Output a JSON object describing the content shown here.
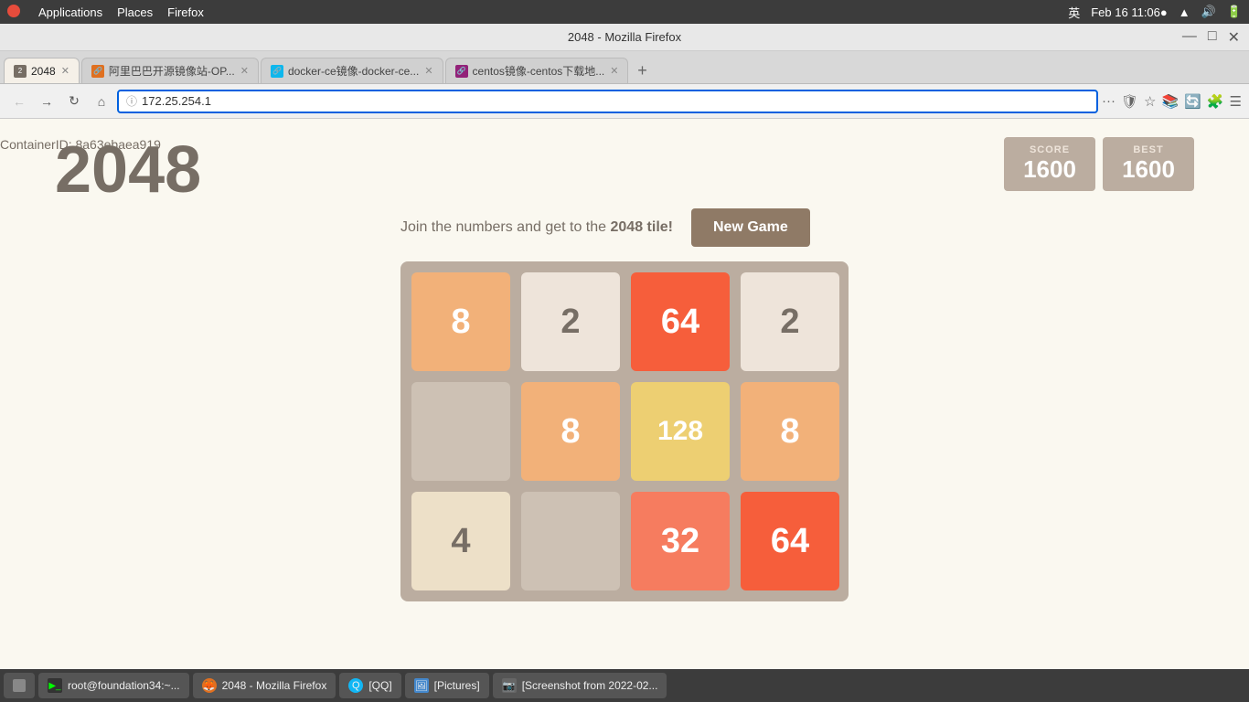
{
  "os": {
    "topbar": {
      "applications": "Applications",
      "places": "Places",
      "firefox": "Firefox",
      "lang": "英",
      "date": "Feb 16  11:06●",
      "wifi_icon": "wifi",
      "speaker_icon": "speaker",
      "battery_icon": "battery"
    }
  },
  "browser": {
    "title": "2048 - Mozilla Firefox",
    "win_controls": [
      "—",
      "□",
      "✕"
    ],
    "tabs": [
      {
        "id": "tab-2048",
        "label": "2048",
        "active": true,
        "icon": "2048"
      },
      {
        "id": "tab-alibaba",
        "label": "阿里巴巴开源镜像站-OP...",
        "active": false,
        "icon": "A"
      },
      {
        "id": "tab-docker",
        "label": "docker-ce镜像-docker-ce...",
        "active": false,
        "icon": "D"
      },
      {
        "id": "tab-centos",
        "label": "centos镜像-centos下载地...",
        "active": false,
        "icon": "C"
      }
    ],
    "new_tab_label": "+",
    "address": "172.25.254.1",
    "nav": {
      "back": "←",
      "forward": "→",
      "refresh": "↻",
      "home": "⌂"
    }
  },
  "game": {
    "title": "2048",
    "container_id": "ContainerID: 8a63ebaea919",
    "subtitle_pre": "Join the numbers and get to the",
    "subtitle_highlight": "2048 tile!",
    "new_game_label": "New Game",
    "score_label": "SCORE",
    "score_value": "1600",
    "best_label": "BEST",
    "best_value": "1600",
    "grid": [
      {
        "value": 8,
        "class": "cell-8"
      },
      {
        "value": 2,
        "class": "cell-2"
      },
      {
        "value": 64,
        "class": "cell-64"
      },
      {
        "value": 2,
        "class": "cell-2"
      },
      {
        "value": "",
        "class": "cell-empty"
      },
      {
        "value": 8,
        "class": "cell-8"
      },
      {
        "value": 128,
        "class": "cell-128"
      },
      {
        "value": 8,
        "class": "cell-8"
      },
      {
        "value": 4,
        "class": "cell-4"
      },
      {
        "value": "",
        "class": "cell-empty"
      },
      {
        "value": 32,
        "class": "cell-32"
      },
      {
        "value": 64,
        "class": "cell-64"
      }
    ]
  },
  "taskbar": {
    "items": [
      {
        "id": "taskbar-desktop",
        "label": "",
        "icon": "desktop"
      },
      {
        "id": "taskbar-terminal",
        "label": "root@foundation34:~...",
        "icon": "terminal"
      },
      {
        "id": "taskbar-firefox",
        "label": "2048 - Mozilla Firefox",
        "icon": "firefox"
      },
      {
        "id": "taskbar-qq",
        "label": "[QQ]",
        "icon": "qq"
      },
      {
        "id": "taskbar-pictures",
        "label": "[Pictures]",
        "icon": "pictures"
      },
      {
        "id": "taskbar-screenshot",
        "label": "[Screenshot from 2022-02...",
        "icon": "screenshot"
      }
    ]
  }
}
